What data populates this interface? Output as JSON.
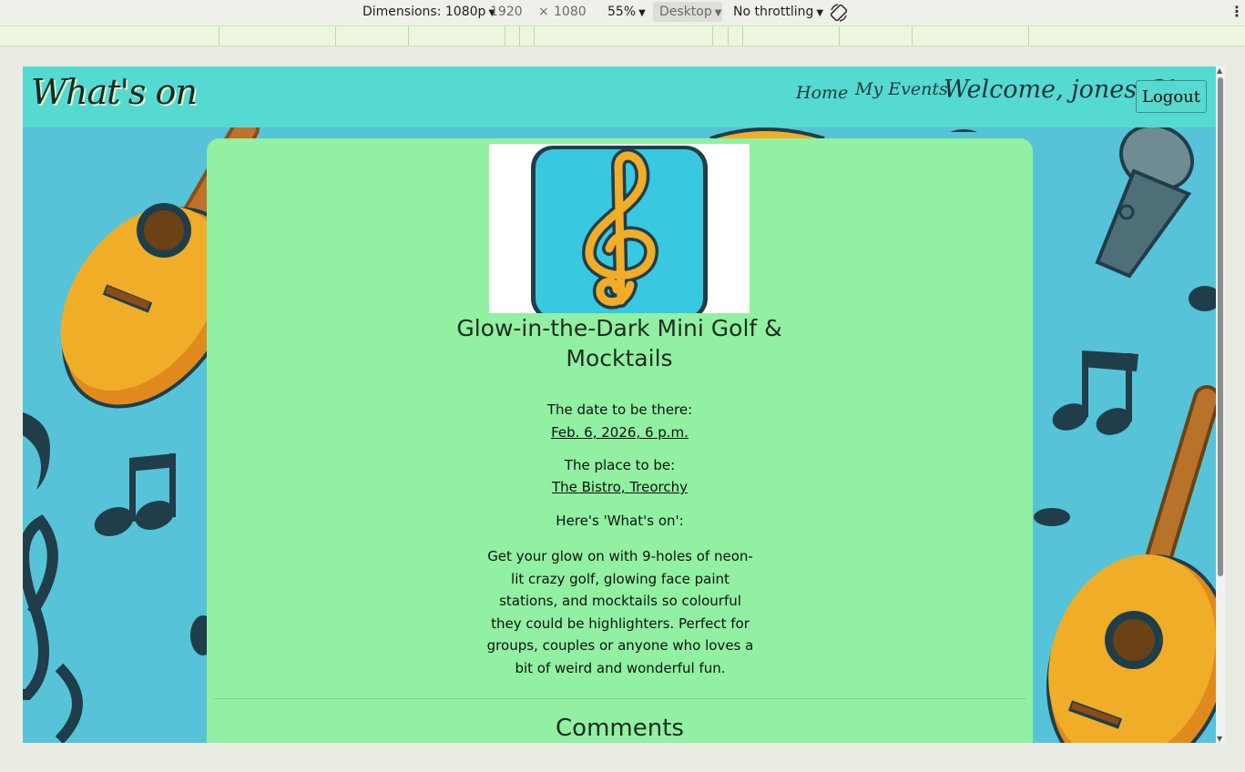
{
  "devtools": {
    "dimensions_label": "Dimensions: 1080p",
    "width": "1920",
    "times": "×",
    "height": "1080",
    "zoom": "55%",
    "device_mode": "Desktop",
    "throttling": "No throttling",
    "caret": "▼",
    "menu_glyph": "⋮"
  },
  "site": {
    "logo": "What's on",
    "nav": {
      "home": "Home",
      "my_events": "My Events"
    },
    "welcome": "Welcome, jonesc3!",
    "logout": "Logout"
  },
  "event": {
    "title": "Glow-in-the-Dark Mini Golf & Mocktails",
    "date_label": "The date to be there:",
    "date_value": "Feb. 6, 2026, 6 p.m.",
    "place_label": "The place to be:",
    "place_value": "The Bistro, Treorchy",
    "whats_on_label": "Here's 'What's on':",
    "description": "Get your glow on with 9-holes of neon-lit crazy golf, glowing face paint stations, and mocktails so colourful they could be highlighters. Perfect for groups, couples or anyone who loves a bit of weird and wonderful fun.",
    "comments_heading": "Comments"
  },
  "colors": {
    "navbar": "#55dad2",
    "background": "#56c3d8",
    "card": "#91f0a2",
    "guitar": "#f0ad27",
    "note": "#203d4a",
    "icon_tile": "#38c8e0"
  },
  "icons": [
    "treble-clef-icon",
    "rotate-icon",
    "kebab-menu-icon",
    "caret-down-icon"
  ]
}
